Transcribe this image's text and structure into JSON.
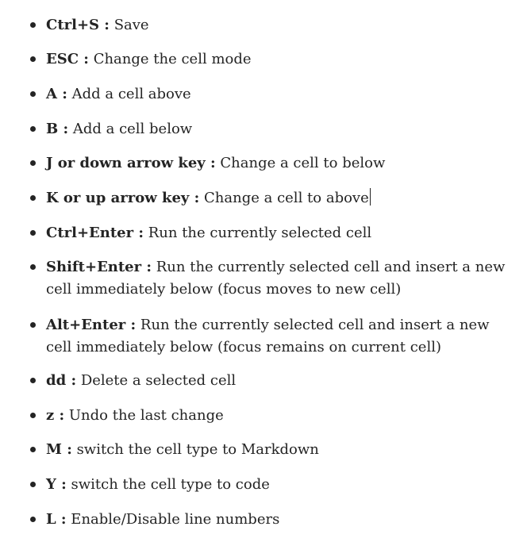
{
  "shortcuts": [
    {
      "key": "Ctrl+S :",
      "desc": " Save"
    },
    {
      "key": "ESC :",
      "desc": " Change the cell mode"
    },
    {
      "key": "A :",
      "desc": " Add a cell above"
    },
    {
      "key": "B :",
      "desc": " Add a cell below"
    },
    {
      "key": "J or down arrow key :",
      "desc": " Change a cell to below"
    },
    {
      "key": "K or up arrow key :",
      "desc": " Change a cell to above"
    },
    {
      "key": "Ctrl+Enter :",
      "desc": " Run the currently selected cell"
    },
    {
      "key": "Shift+Enter :",
      "desc": " Run the currently selected cell and insert a new cell immediately below (focus moves to new cell)"
    },
    {
      "key": "Alt+Enter :",
      "desc": " Run the currently selected cell and insert a new cell immediately below (focus remains on current cell)"
    },
    {
      "key": "dd :",
      "desc": " Delete a selected cell"
    },
    {
      "key": "z :",
      "desc": " Undo the last change"
    },
    {
      "key": "M :",
      "desc": " switch the cell type to Markdown"
    },
    {
      "key": "Y :",
      "desc": " switch the cell type to code"
    },
    {
      "key": "L :",
      "desc": " Enable/Disable line numbers"
    }
  ]
}
